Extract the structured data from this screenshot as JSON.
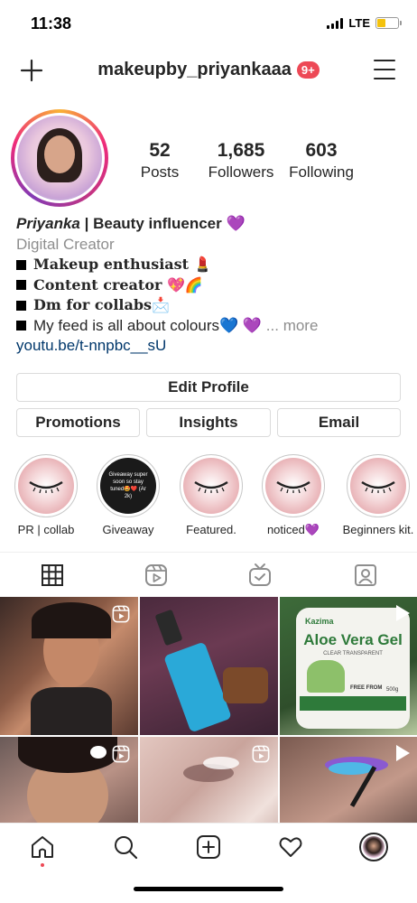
{
  "status_bar": {
    "time": "11:38",
    "network": "LTE"
  },
  "header": {
    "username": "makeupby_priyankaaa",
    "notification_badge": "9+"
  },
  "profile": {
    "stats": [
      {
        "value": "52",
        "label": "Posts"
      },
      {
        "value": "1,685",
        "label": "Followers"
      },
      {
        "value": "603",
        "label": "Following"
      }
    ],
    "bio": {
      "name": "Priyanka",
      "headline": "| Beauty influencer 💜",
      "category": "Digital Creator",
      "lines": [
        "Makeup enthusiast 💄",
        "Content creator 💖🌈",
        "Dm for collabs📩",
        "My feed is all about colours💙 💜"
      ],
      "more": "... more",
      "link": "youtu.be/t-nnpbc__sU"
    }
  },
  "buttons": {
    "edit_profile": "Edit Profile",
    "promotions": "Promotions",
    "insights": "Insights",
    "email": "Email"
  },
  "highlights": [
    {
      "label": "PR | collab"
    },
    {
      "label": "Giveaway",
      "cover_text": "Giveaway super soon so stay tuned🤩❤️ (Ar 2k)"
    },
    {
      "label": "Featured."
    },
    {
      "label": "noticed💜"
    },
    {
      "label": "Beginners kit."
    }
  ],
  "posts": [
    {
      "type": "reel"
    },
    {
      "type": "photo"
    },
    {
      "type": "video",
      "product_brand": "Kazima",
      "product_title": "Aloe Vera Gel",
      "product_subtitle": "CLEAR TRANSPARENT",
      "product_free": "FREE FROM",
      "product_weight": "500g"
    },
    {
      "type": "reel"
    },
    {
      "type": "reel"
    },
    {
      "type": "video"
    }
  ],
  "colors": {
    "accent_red": "#ed4956",
    "link_blue": "#00376b",
    "battery": "#f4c20d"
  }
}
